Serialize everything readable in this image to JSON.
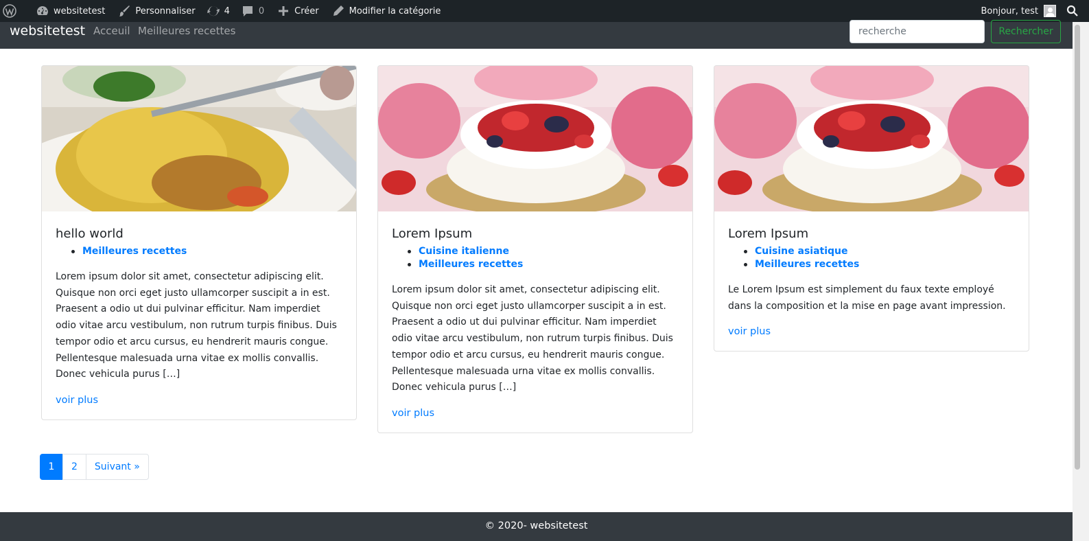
{
  "admin_bar": {
    "site_name": "websitetest",
    "customize": "Personnaliser",
    "updates_count": "4",
    "comments_count": "0",
    "new": "Créer",
    "edit_category": "Modifier la catégorie",
    "greeting": "Bonjour, test"
  },
  "navbar": {
    "brand": "websitetest",
    "links": [
      "Acceuil",
      "Meilleures recettes"
    ],
    "search_placeholder": "recherche",
    "search_button": "Rechercher"
  },
  "posts": [
    {
      "image": "spaghetti-photo",
      "title": "hello world",
      "categories": [
        "Meilleures recettes"
      ],
      "excerpt": "Lorem ipsum dolor sit amet, consectetur adipiscing elit. Quisque non orci eget justo ullamcorper suscipit a in est. Praesent a odio ut dui pulvinar efficitur. Nam imperdiet odio vitae arcu vestibulum, non rutrum turpis finibus. Duis tempor odio et arcu cursus, eu hendrerit mauris congue. Pellentesque malesuada urna vitae ex mollis convallis. Donec vehicula purus […]",
      "more": "voir plus"
    },
    {
      "image": "strawberry-cake-photo",
      "title": "Lorem Ipsum",
      "categories": [
        "Cuisine italienne",
        "Meilleures recettes"
      ],
      "excerpt": "Lorem ipsum dolor sit amet, consectetur adipiscing elit. Quisque non orci eget justo ullamcorper suscipit a in est. Praesent a odio ut dui pulvinar efficitur. Nam imperdiet odio vitae arcu vestibulum, non rutrum turpis finibus. Duis tempor odio et arcu cursus, eu hendrerit mauris congue. Pellentesque malesuada urna vitae ex mollis convallis. Donec vehicula purus […]",
      "more": "voir plus"
    },
    {
      "image": "strawberry-cake-photo",
      "title": "Lorem Ipsum",
      "categories": [
        "Cuisine asiatique",
        "Meilleures recettes"
      ],
      "excerpt": "Le Lorem Ipsum est simplement du faux texte employé dans la composition et la mise en page avant impression.",
      "more": "voir plus"
    }
  ],
  "pagination": {
    "pages": [
      "1",
      "2"
    ],
    "current": "1",
    "next": "Suivant »"
  },
  "footer": {
    "text": "© 2020- websitetest"
  },
  "colors": {
    "admin_bar": "#1d2327",
    "navbar": "#343a40",
    "link": "#007bff",
    "success": "#28a745"
  }
}
